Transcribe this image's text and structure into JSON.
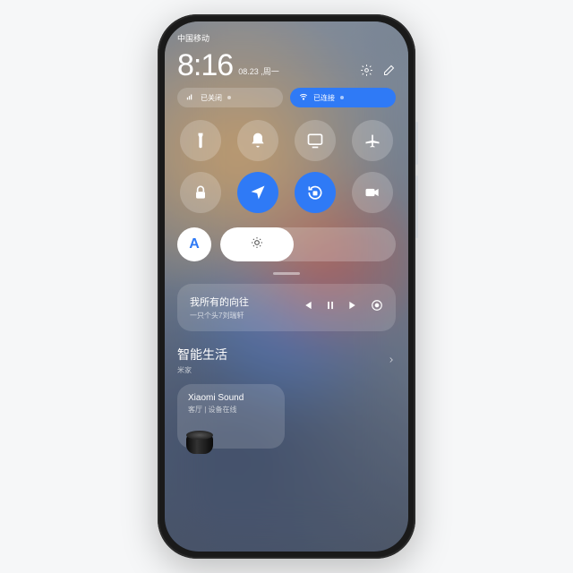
{
  "status": {
    "carrier": "中国移动",
    "bt_icon": "bluetooth-icon",
    "signal_icon": "signal-icon",
    "wifi_icon": "wifi-icon",
    "battery_icon": "battery-icon"
  },
  "clock": {
    "time": "8:16",
    "date": "08.23 ,周一"
  },
  "pills": {
    "left_label": "已关闭",
    "right_label": "已连接"
  },
  "tiles": [
    {
      "name": "flashlight",
      "active": false
    },
    {
      "name": "bell",
      "active": false
    },
    {
      "name": "cast",
      "active": false
    },
    {
      "name": "airplane",
      "active": false
    },
    {
      "name": "lock",
      "active": false
    },
    {
      "name": "location",
      "active": true
    },
    {
      "name": "rotate-lock",
      "active": true
    },
    {
      "name": "video",
      "active": false
    }
  ],
  "brightness": {
    "auto_label": "A",
    "percent": 42
  },
  "media": {
    "title": "我所有的向往",
    "subtitle": "一只个头7刘瑞轩"
  },
  "smart": {
    "heading": "智能生活",
    "sub": "米家"
  },
  "device": {
    "name": "Xiaomi Sound",
    "status": "客厅 | 设备在线"
  }
}
